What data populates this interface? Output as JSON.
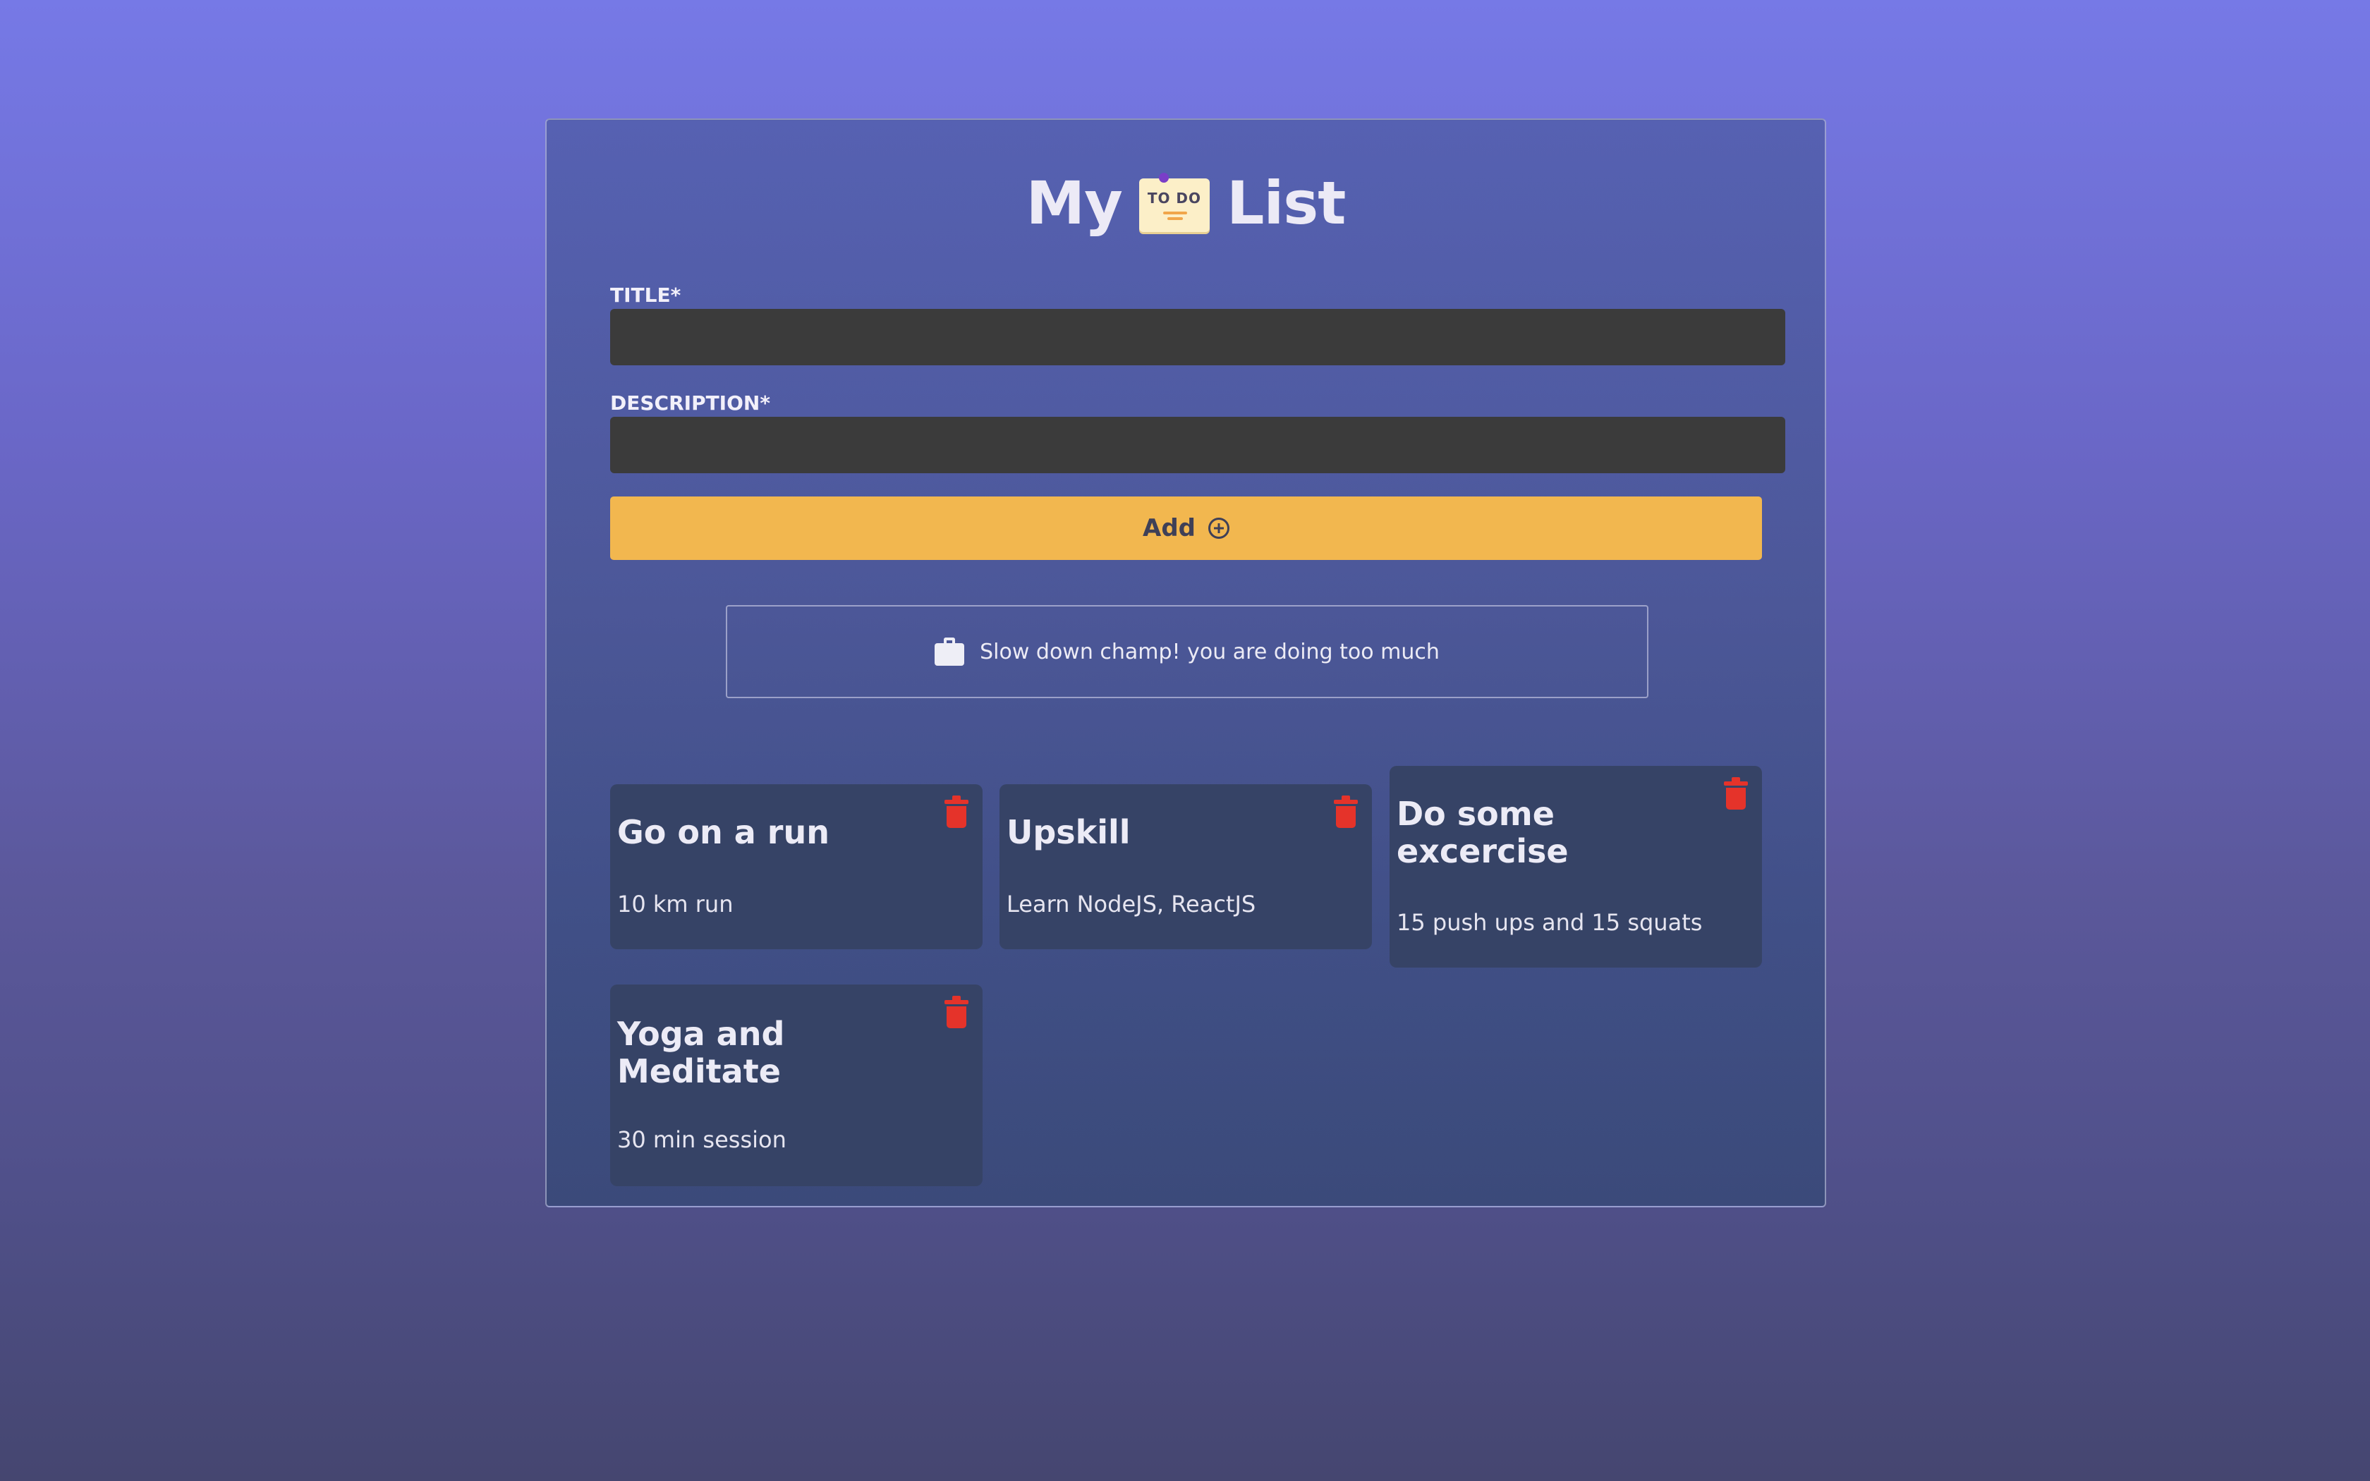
{
  "app": {
    "title_prefix": "My",
    "title_suffix": "List",
    "logo_text": "TO DO"
  },
  "form": {
    "title_label": "TITLE*",
    "title_value": "",
    "description_label": "DESCRIPTION*",
    "description_value": "",
    "add_label": "Add"
  },
  "notice": {
    "message": "Slow down champ! you are doing too much",
    "icon": "briefcase-icon"
  },
  "todos": [
    {
      "title": "Go on a run",
      "description": "10 km run"
    },
    {
      "title": "Upskill",
      "description": "Learn NodeJS, ReactJS"
    },
    {
      "title": "Do some excercise",
      "description": "15 push ups and 15 squats"
    },
    {
      "title": "Yoga and Meditate",
      "description": "30 min session"
    }
  ],
  "colors": {
    "accent": "#f2b74f",
    "delete": "#e5332a",
    "card": "#364366",
    "input": "#3b3b3b"
  }
}
